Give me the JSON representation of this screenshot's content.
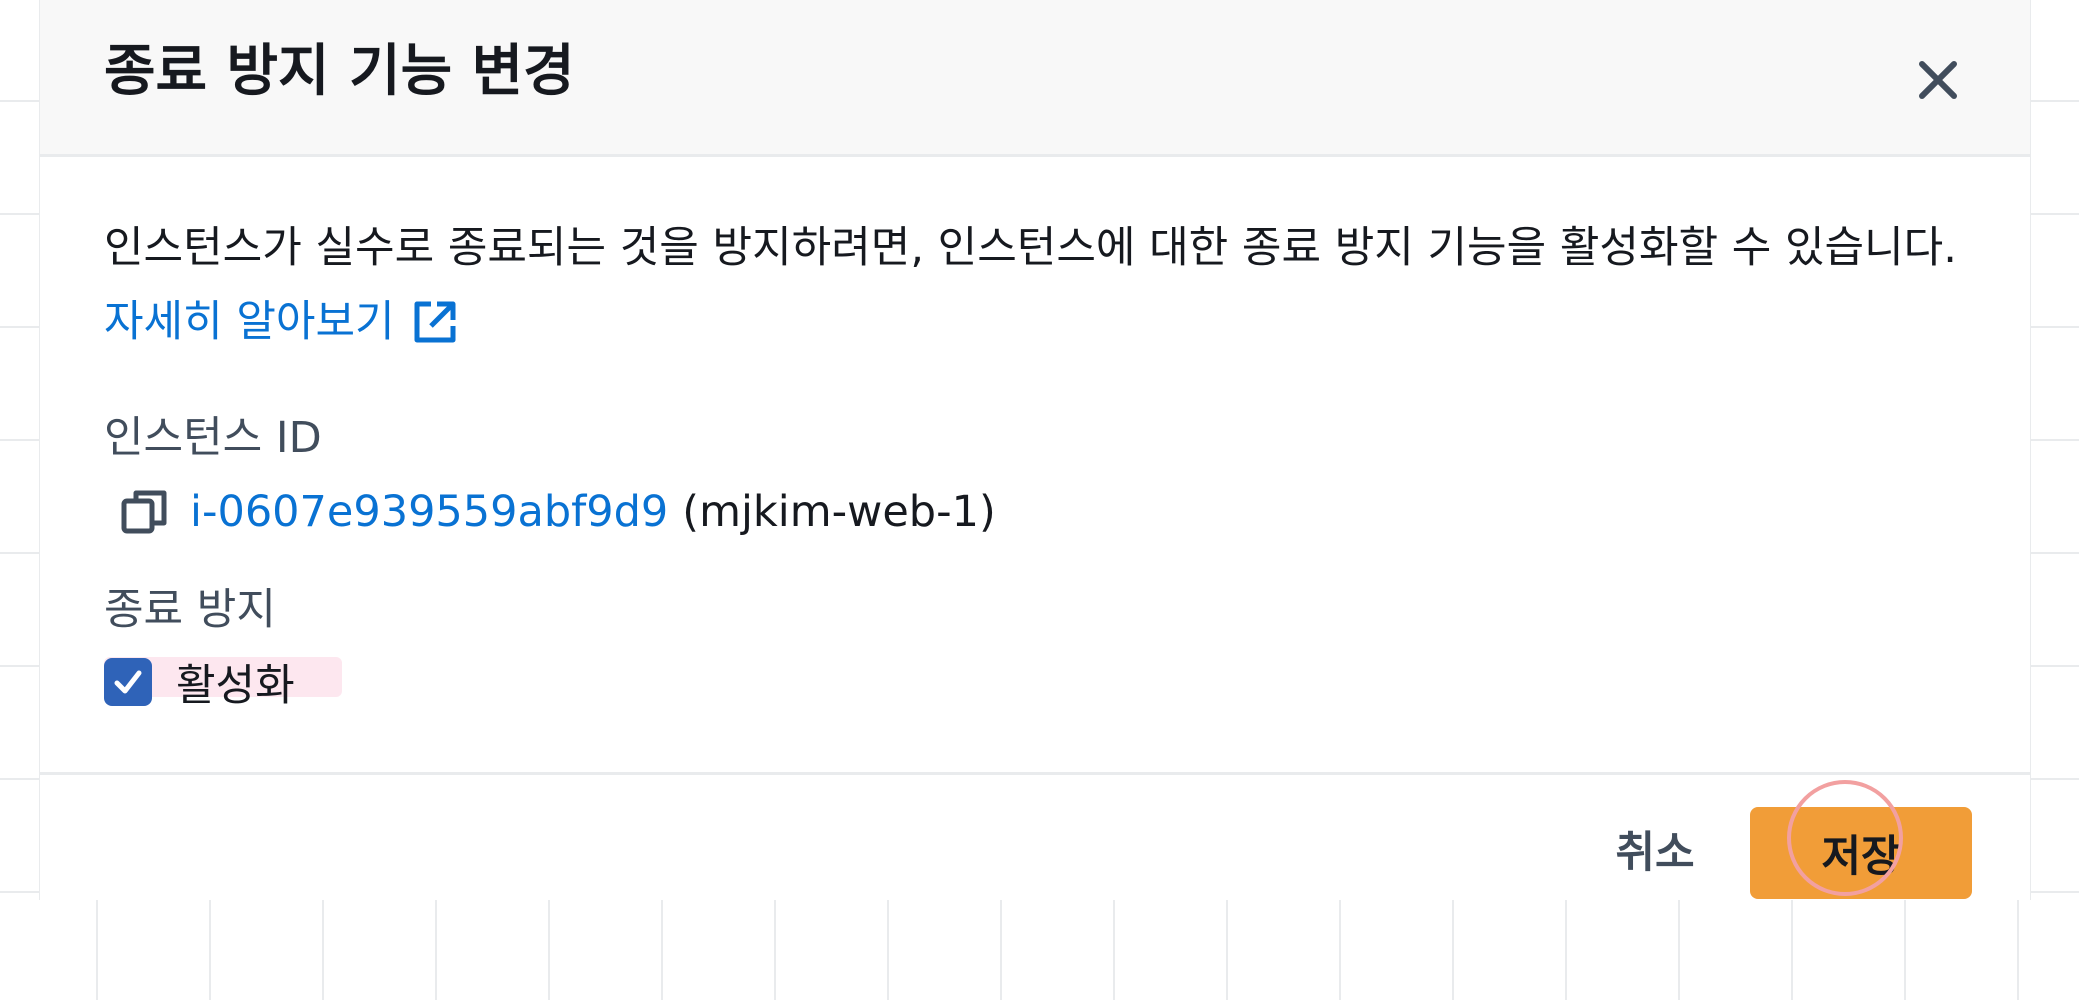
{
  "modal": {
    "title": "종료 방지 기능 변경",
    "close_icon": "close-icon",
    "description": "인스턴스가 실수로 종료되는 것을 방지하려면, 인스턴스에 대한 종료 방지 기능을 활성화할 수 있습니다.",
    "learn_more_label": "자세히 알아보기",
    "learn_more_icon": "external-link-icon",
    "instance_id_label": "인스턴스 ID",
    "instance": {
      "id": "i-0607e939559abf9d9",
      "name": "(mjkim-web-1)",
      "copy_icon": "copy-icon"
    },
    "termination_protection_label": "종료 방지",
    "checkbox": {
      "label": "활성화",
      "checked": true
    },
    "footer": {
      "cancel_label": "취소",
      "save_label": "저장"
    }
  },
  "colors": {
    "link": "#0972d3",
    "primary_button": "#f19d38",
    "checkbox": "#2f63b8",
    "header_background": "#f8f8f8"
  }
}
